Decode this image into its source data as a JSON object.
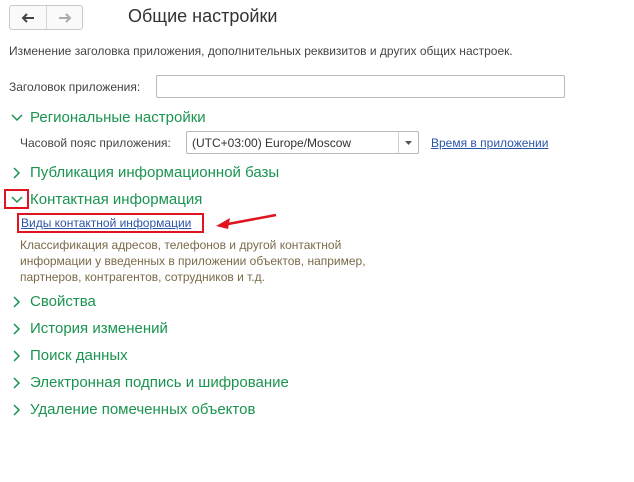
{
  "nav": {
    "back_icon": "arrow-left-icon",
    "forward_icon": "arrow-right-icon"
  },
  "title": "Общие настройки",
  "description": "Изменение заголовка приложения, дополнительных реквизитов и других общих настроек.",
  "app_title_field": {
    "label": "Заголовок приложения:",
    "value": ""
  },
  "regional": {
    "header": "Региональные настройки",
    "tz_label": "Часовой пояс приложения:",
    "tz_value": "(UTC+03:00) Europe/Moscow",
    "time_link": "Время в приложении"
  },
  "sections": {
    "publication": "Публикация информационной базы",
    "contact": "Контактная информация",
    "properties": "Свойства",
    "history": "История изменений",
    "search": "Поиск данных",
    "signature": "Электронная подпись и шифрование",
    "deletion": "Удаление помеченных объектов"
  },
  "contact": {
    "link": "Виды контактной информации",
    "description": "Классификация адресов, телефонов и другой контактной информации у введенных в приложении объектов, например, партнеров, контрагентов, сотрудников и т.д."
  },
  "colors": {
    "accent_green": "#1a9450",
    "link_blue": "#2c55a8",
    "annotation_red": "#e0141e",
    "desc_brown": "#7a6a4a"
  }
}
